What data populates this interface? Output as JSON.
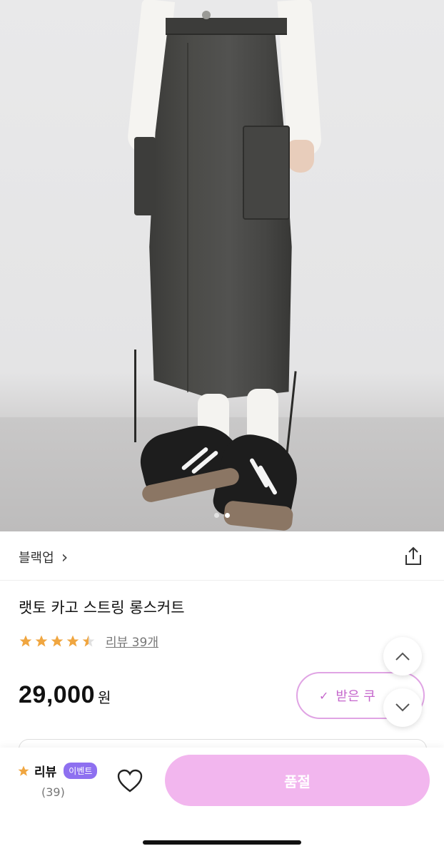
{
  "gallery": {
    "slide_count": 2,
    "active_index": 1
  },
  "brand": {
    "name": "블랙업",
    "chevron": "›"
  },
  "share": {
    "icon": "share-icon"
  },
  "product": {
    "title": "랫토 카고 스트링 롱스커트",
    "rating": 4.5,
    "review_link": "리뷰 39개",
    "price": "29,000",
    "currency": "원"
  },
  "coupon": {
    "check": "✓",
    "label": "받은 쿠"
  },
  "scroll": {
    "up_icon": "chevron-up-icon",
    "down_icon": "chevron-down-icon"
  },
  "bottom_bar": {
    "review_label": "리뷰",
    "event_badge": "이벤트",
    "review_count": "(39)",
    "soldout_label": "품절"
  },
  "colors": {
    "accent_pink": "#f2b6ee",
    "coupon_pink": "#c566cc",
    "badge_purple": "#8e70f0",
    "star": "#f0a640"
  }
}
